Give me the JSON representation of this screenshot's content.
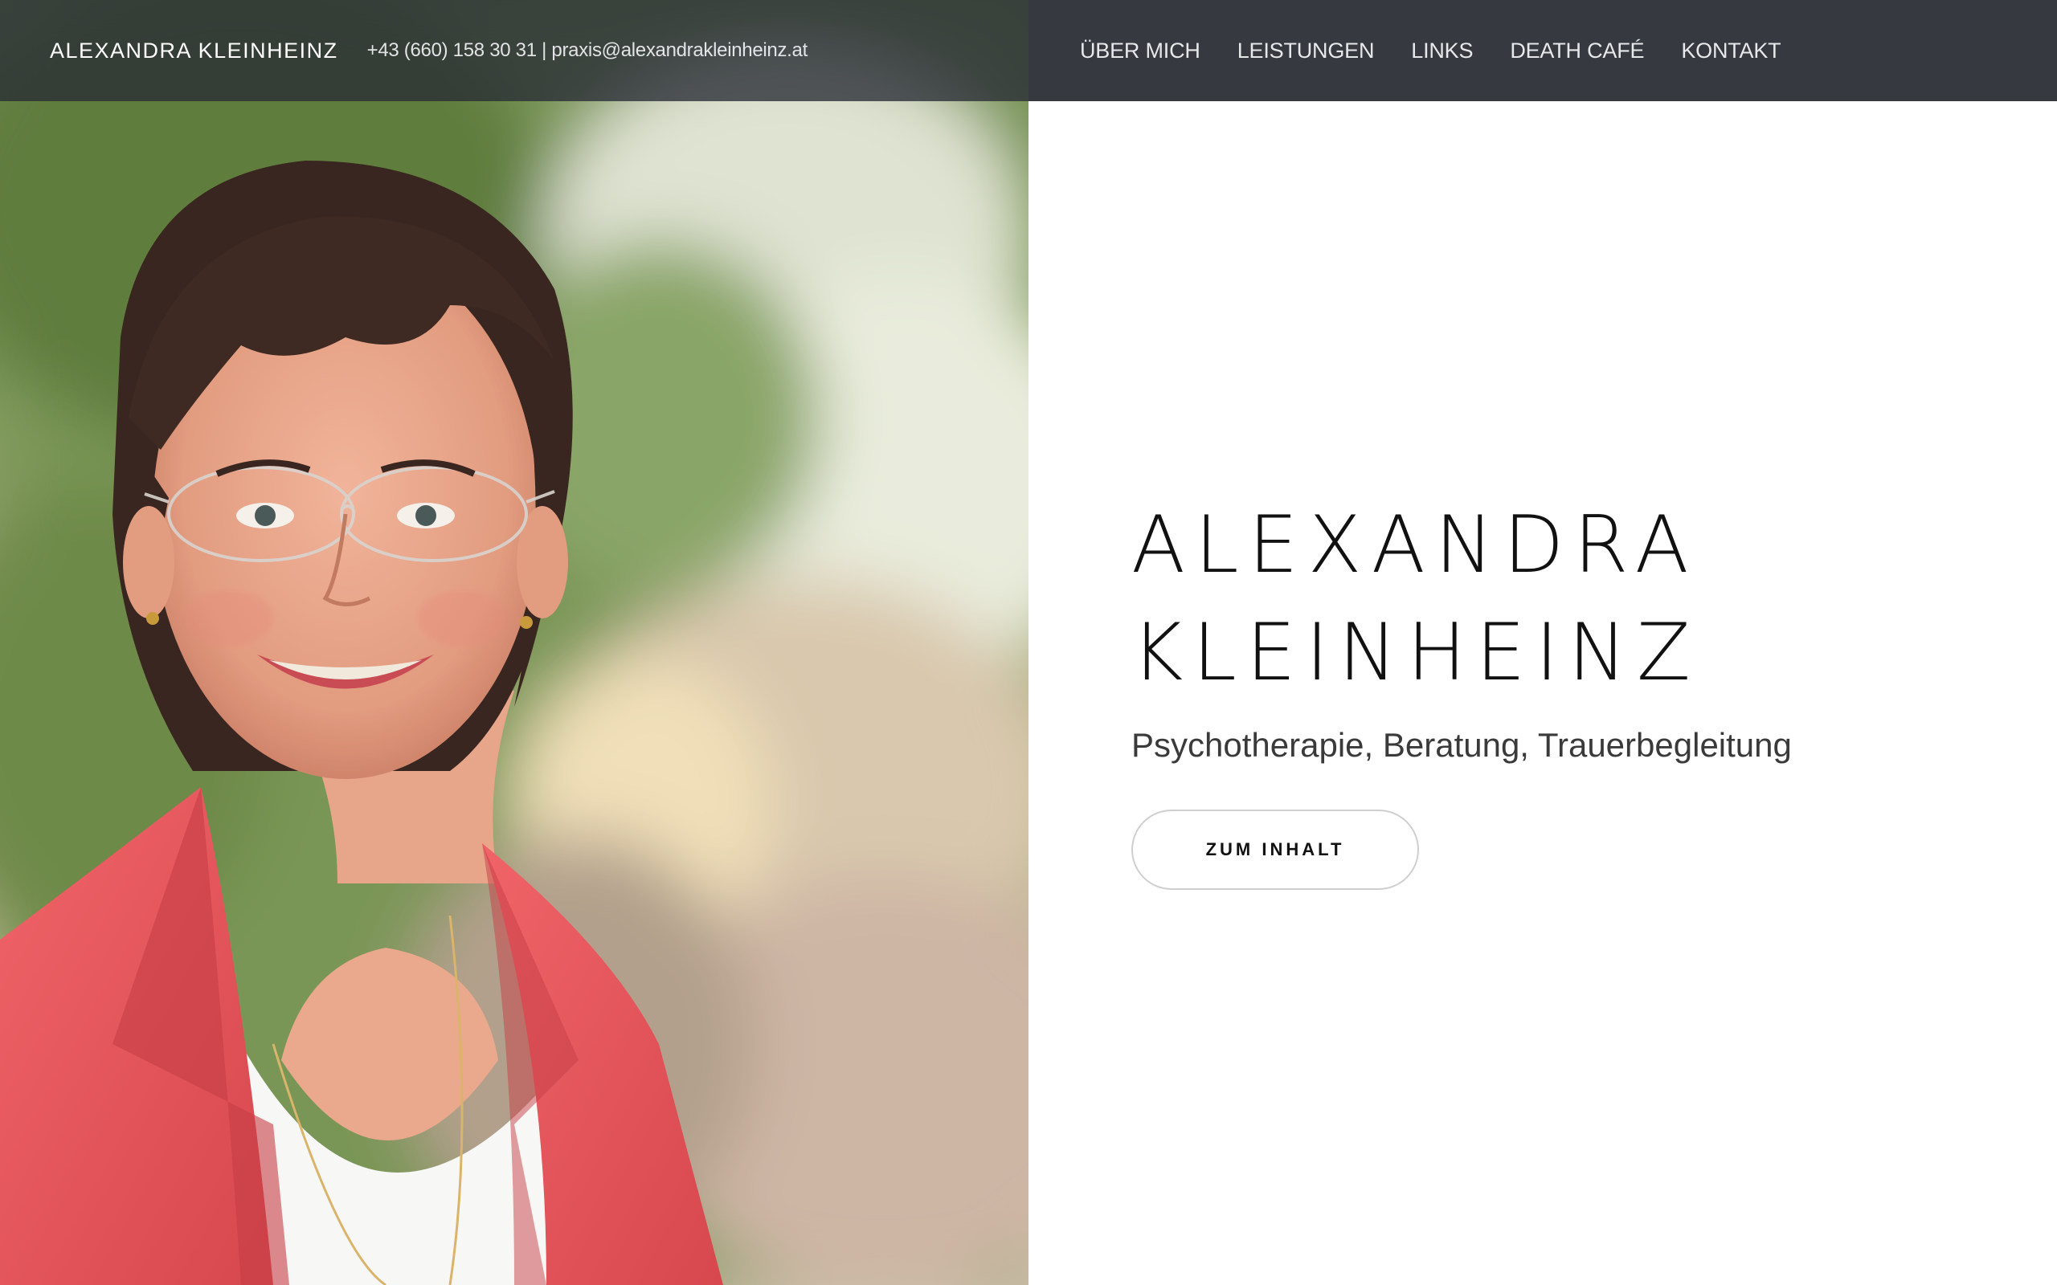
{
  "header": {
    "brand": "ALEXANDRA KLEINHEINZ",
    "contact": "+43 (660) 158 30 31 | praxis@alexandrakleinheinz.at",
    "nav": [
      {
        "label": "ÜBER MICH"
      },
      {
        "label": "LEISTUNGEN"
      },
      {
        "label": "LINKS"
      },
      {
        "label": "DEATH CAFÉ"
      },
      {
        "label": "KONTAKT"
      }
    ]
  },
  "hero": {
    "title_line1": "ALEXANDRA",
    "title_line2": "KLEINHEINZ",
    "subtitle": "Psychotherapie, Beratung, Trauerbegleitung",
    "cta_label": "ZUM INHALT",
    "photo_icon": "portrait-photo"
  },
  "colors": {
    "topbar_left": "#282c34",
    "topbar_right": "#363940",
    "jacket": "#e8545a",
    "title_text": "#111111"
  }
}
